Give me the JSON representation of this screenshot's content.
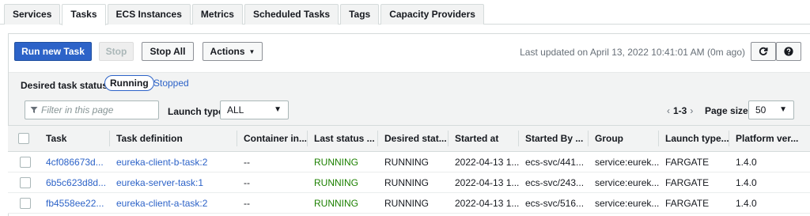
{
  "tabs": [
    {
      "label": "Services",
      "active": false
    },
    {
      "label": "Tasks",
      "active": true
    },
    {
      "label": "ECS Instances",
      "active": false
    },
    {
      "label": "Metrics",
      "active": false
    },
    {
      "label": "Scheduled Tasks",
      "active": false
    },
    {
      "label": "Tags",
      "active": false
    },
    {
      "label": "Capacity Providers",
      "active": false
    }
  ],
  "toolbar": {
    "run_new_task": "Run new Task",
    "stop": "Stop",
    "stop_all": "Stop All",
    "actions": "Actions",
    "last_updated": "Last updated on April 13, 2022 10:41:01 AM (0m ago)",
    "refresh_icon": "refresh-icon",
    "help_icon": "help-icon"
  },
  "filters": {
    "desired_status_label": "Desired task status:",
    "running": "Running",
    "stopped": "Stopped",
    "filter_placeholder": "Filter in this page",
    "launch_type_label": "Launch type",
    "launch_type_value": "ALL",
    "pagination": "1-3",
    "page_size_label": "Page size",
    "page_size_value": "50"
  },
  "table": {
    "columns": [
      "Task",
      "Task definition",
      "Container in...",
      "Last status ...",
      "Desired stat...",
      "Started at",
      "Started By ...",
      "Group",
      "Launch type...",
      "Platform ver..."
    ],
    "rows": [
      [
        "4cf086673d...",
        "eureka-client-b-task:2",
        "--",
        "RUNNING",
        "RUNNING",
        "2022-04-13 1...",
        "ecs-svc/441...",
        "service:eurek...",
        "FARGATE",
        "1.4.0"
      ],
      [
        "6b5c623d8d...",
        "eureka-server-task:1",
        "--",
        "RUNNING",
        "RUNNING",
        "2022-04-13 1...",
        "ecs-svc/243...",
        "service:eurek...",
        "FARGATE",
        "1.4.0"
      ],
      [
        "fb4558ee22...",
        "eureka-client-a-task:2",
        "--",
        "RUNNING",
        "RUNNING",
        "2022-04-13 1...",
        "ecs-svc/516...",
        "service:eurek...",
        "FARGATE",
        "1.4.0"
      ]
    ]
  },
  "colors": {
    "primary": "#2d63c8",
    "running_text": "#1d8102",
    "header_bg": "#f2f3f3"
  }
}
